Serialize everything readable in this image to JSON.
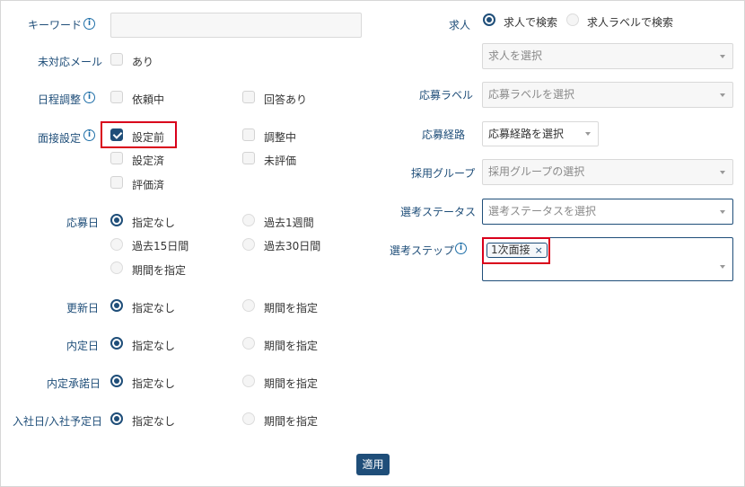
{
  "filters": {
    "keyword": {
      "label": "キーワード",
      "value": ""
    },
    "unhandled_mail": {
      "label": "未対応メール",
      "options": [
        {
          "label": "あり",
          "checked": false
        }
      ]
    },
    "schedule": {
      "label": "日程調整",
      "options": [
        {
          "label": "依頼中",
          "checked": false
        },
        {
          "label": "回答あり",
          "checked": false
        }
      ]
    },
    "interview_setup": {
      "label": "面接設定",
      "options": [
        {
          "label": "設定前",
          "checked": true
        },
        {
          "label": "調整中",
          "checked": false
        },
        {
          "label": "設定済",
          "checked": false
        },
        {
          "label": "未評価",
          "checked": false
        },
        {
          "label": "評価済",
          "checked": false
        }
      ]
    },
    "application_date": {
      "label": "応募日",
      "options": [
        {
          "label": "指定なし",
          "selected": true
        },
        {
          "label": "過去1週間",
          "selected": false
        },
        {
          "label": "過去15日間",
          "selected": false
        },
        {
          "label": "過去30日間",
          "selected": false
        },
        {
          "label": "期間を指定",
          "selected": false
        }
      ]
    },
    "updated_date": {
      "label": "更新日",
      "options": [
        {
          "label": "指定なし",
          "selected": true
        },
        {
          "label": "期間を指定",
          "selected": false
        }
      ]
    },
    "offer_date": {
      "label": "内定日",
      "options": [
        {
          "label": "指定なし",
          "selected": true
        },
        {
          "label": "期間を指定",
          "selected": false
        }
      ]
    },
    "offer_accept_date": {
      "label": "内定承諾日",
      "options": [
        {
          "label": "指定なし",
          "selected": true
        },
        {
          "label": "期間を指定",
          "selected": false
        }
      ]
    },
    "join_date": {
      "label": "入社日/入社予定日",
      "options": [
        {
          "label": "指定なし",
          "selected": true
        },
        {
          "label": "期間を指定",
          "selected": false
        }
      ]
    }
  },
  "right": {
    "job": {
      "label": "求人",
      "modes": [
        {
          "label": "求人で検索",
          "selected": true
        },
        {
          "label": "求人ラベルで検索",
          "selected": false
        }
      ],
      "placeholder": "求人を選択"
    },
    "apply_label": {
      "label": "応募ラベル",
      "placeholder": "応募ラベルを選択"
    },
    "apply_route": {
      "label": "応募経路",
      "value": "応募経路を選択"
    },
    "recruit_group": {
      "label": "採用グループ",
      "placeholder": "採用グループの選択"
    },
    "selection_status": {
      "label": "選考ステータス",
      "placeholder": "選考ステータスを選択"
    },
    "selection_step": {
      "label": "選考ステップ",
      "tags": [
        {
          "label": "1次面接",
          "remove": "×"
        }
      ]
    }
  },
  "apply_button": "適用",
  "colors": {
    "primary": "#1f4e79",
    "highlight": "#d9001b",
    "info": "#1f6fa8"
  }
}
